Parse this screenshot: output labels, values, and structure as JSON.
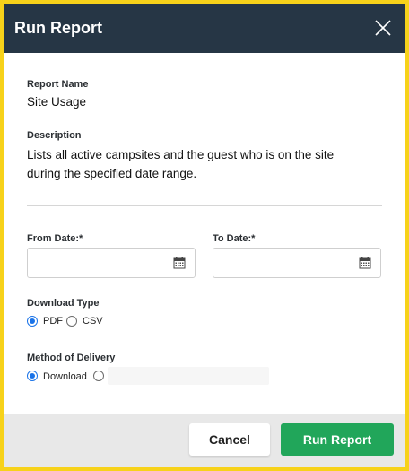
{
  "dialog": {
    "title": "Run Report",
    "close_icon": "close-icon"
  },
  "report": {
    "name_label": "Report Name",
    "name_value": "Site Usage",
    "description_label": "Description",
    "description_value": "Lists all active campsites and the guest who is on the site during the specified date range."
  },
  "dates": {
    "from_label": "From Date:*",
    "from_value": "",
    "to_label": "To Date:*",
    "to_value": "",
    "calendar_icon": "calendar-icon"
  },
  "download_type": {
    "label": "Download Type",
    "options": [
      {
        "label": "PDF",
        "selected": true
      },
      {
        "label": "CSV",
        "selected": false
      }
    ]
  },
  "delivery": {
    "label": "Method of Delivery",
    "options": [
      {
        "label": "Download",
        "selected": true
      },
      {
        "label": "",
        "selected": false
      }
    ]
  },
  "footer": {
    "cancel_label": "Cancel",
    "run_label": "Run Report"
  },
  "colors": {
    "header_bg": "#263645",
    "accent_green": "#21a65a",
    "radio_blue": "#1a73e8",
    "page_border": "#f7d21a"
  }
}
